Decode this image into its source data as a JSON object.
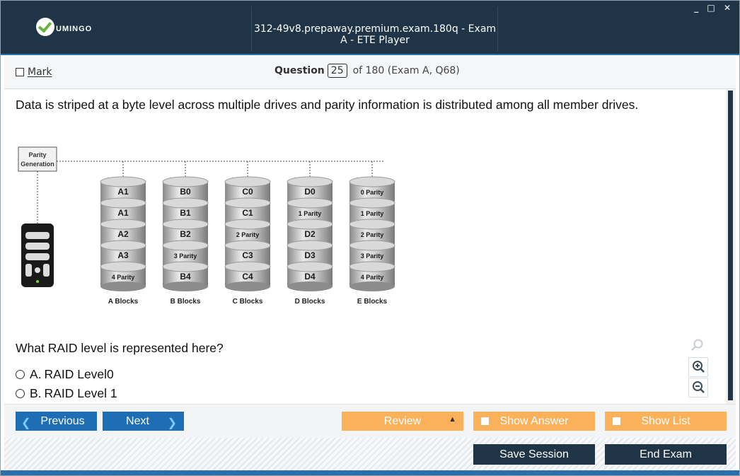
{
  "window": {
    "title": "312-49v8.prepaway.premium.exam.180q - Exam A - ETE Player",
    "logo_text": "UMINGO",
    "controls": "_ □ ✕"
  },
  "question_bar": {
    "mark_label": "Mark",
    "question_label": "Question",
    "question_number": "25",
    "of_text": "of 180 (Exam A, Q68)"
  },
  "question": {
    "text": "Data is striped at a byte level across multiple drives and parity information is distributed among all member drives.",
    "prompt": "What RAID level is represented here?",
    "options": [
      {
        "letter": "A.",
        "text": "RAID Level0"
      },
      {
        "letter": "B.",
        "text": "RAID Level 1"
      }
    ]
  },
  "diagram": {
    "parity_label_1": "Parity",
    "parity_label_2": "Generation",
    "columns": [
      {
        "label": "A Blocks",
        "cells": [
          "A1",
          "A1",
          "A2",
          "A3",
          "4 Parity"
        ]
      },
      {
        "label": "B Blocks",
        "cells": [
          "B0",
          "B1",
          "B2",
          "3 Parity",
          "B4"
        ]
      },
      {
        "label": "C Blocks",
        "cells": [
          "C0",
          "C1",
          "2 Parity",
          "C3",
          "C4"
        ]
      },
      {
        "label": "D Blocks",
        "cells": [
          "D0",
          "1 Parity",
          "D2",
          "D3",
          "D4"
        ]
      },
      {
        "label": "E Blocks",
        "cells": [
          "0 Parity",
          "1 Parity",
          "2 Parity",
          "3 Parity",
          "4 Parity"
        ]
      }
    ]
  },
  "zoom": {
    "search": "search-icon",
    "zoom_in": "zoom-in-icon",
    "zoom_out": "zoom-out-icon"
  },
  "nav": {
    "previous": "Previous",
    "next": "Next",
    "review": "Review",
    "show_answer": "Show Answer",
    "show_list": "Show List",
    "save_session": "Save Session",
    "end_exam": "End Exam"
  },
  "colors": {
    "titlebar": "#1f3547",
    "accent_blue": "#1e6eb5",
    "orange": "#fbb05a",
    "navy": "#1f3547"
  }
}
